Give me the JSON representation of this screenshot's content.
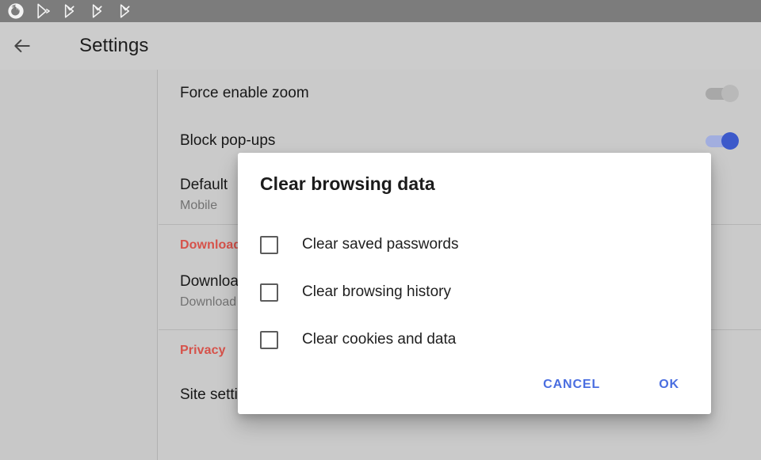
{
  "statusbar": {
    "icons": [
      {
        "name": "firefox-icon"
      },
      {
        "name": "play-store-icon"
      },
      {
        "name": "download-complete-icon-1"
      },
      {
        "name": "download-complete-icon-2"
      },
      {
        "name": "download-complete-icon-3"
      }
    ]
  },
  "appbar": {
    "back_icon": "back-arrow-icon",
    "title": "Settings"
  },
  "settings": [
    {
      "type": "row",
      "title": "Force enable zoom",
      "sub": "",
      "toggle": "off"
    },
    {
      "type": "row",
      "title": "Block pop-ups",
      "sub": "",
      "toggle": "on"
    },
    {
      "type": "row",
      "title": "Default",
      "sub": "Mobile",
      "toggle": ""
    },
    {
      "type": "divider"
    },
    {
      "type": "section",
      "title": "Downloads"
    },
    {
      "type": "row",
      "title": "Download",
      "sub": "Download",
      "toggle": ""
    },
    {
      "type": "divider"
    },
    {
      "type": "section",
      "title": "Privacy"
    },
    {
      "type": "row",
      "title": "Site settings",
      "sub": "",
      "toggle": ""
    }
  ],
  "dialog": {
    "title": "Clear browsing data",
    "options": [
      {
        "label": "Clear saved passwords",
        "checked": false
      },
      {
        "label": "Clear browsing history",
        "checked": false
      },
      {
        "label": "Clear cookies and data",
        "checked": false
      }
    ],
    "cancel_label": "CANCEL",
    "ok_label": "OK"
  },
  "colors": {
    "status_bar": "#828282",
    "app_bar": "#d6d6d6",
    "content_bg": "#d4d4d4",
    "section_header": "#e0564e",
    "toggle_on": "#3f5ed4",
    "dialog_action": "#4a6ee0"
  }
}
